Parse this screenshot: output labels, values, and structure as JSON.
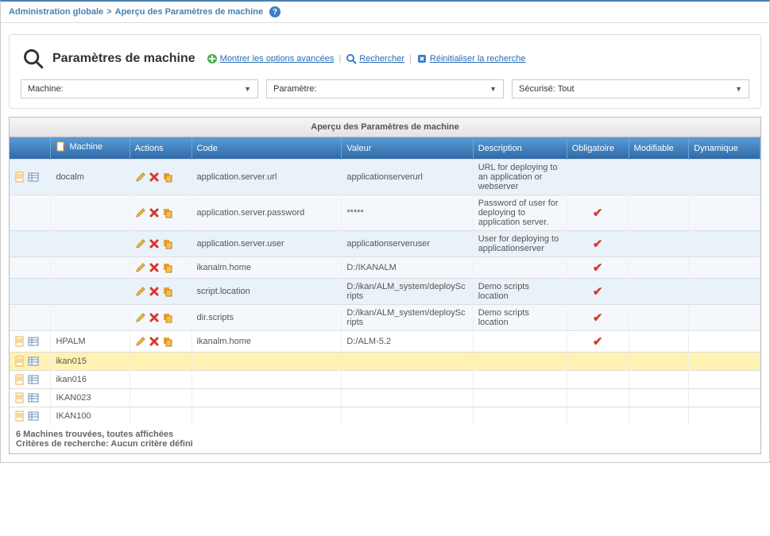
{
  "breadcrumb": {
    "root": "Administration globale",
    "sep": ">",
    "current": "Aperçu des Paramètres de machine"
  },
  "search": {
    "title": "Paramètres de machine",
    "advanced": "Montrer les options avancées",
    "search": "Rechercher",
    "reset": "Réinitialiser la recherche"
  },
  "filters": {
    "machine": "Machine:",
    "param": "Paramètre:",
    "secure": "Sécurisé: Tout"
  },
  "table": {
    "title": "Aperçu des Paramètres de machine",
    "headers": {
      "blank": "",
      "machine": "Machine",
      "actions": "Actions",
      "code": "Code",
      "value": "Valeur",
      "description": "Description",
      "mandatory": "Obligatoire",
      "editable": "Modifiable",
      "dynamic": "Dynamique"
    },
    "rows": [
      {
        "kind": "param",
        "alt": false,
        "showMachine": true,
        "machine": "docalm",
        "code": "application.server.url",
        "value": "applicationserverurl",
        "desc": "URL for deploying to an application or webserver",
        "mandatory": false
      },
      {
        "kind": "param",
        "alt": true,
        "showMachine": false,
        "machine": "",
        "code": "application.server.password",
        "value": "*****",
        "desc": "Password of user for deploying to application server.",
        "mandatory": true
      },
      {
        "kind": "param",
        "alt": false,
        "showMachine": false,
        "machine": "",
        "code": "application.server.user",
        "value": "applicationserveruser",
        "desc": "User for deploying to applicationserver",
        "mandatory": true
      },
      {
        "kind": "param",
        "alt": true,
        "showMachine": false,
        "machine": "",
        "code": "ikanalm.home",
        "value": "D:/IKANALM",
        "desc": "",
        "mandatory": true
      },
      {
        "kind": "param",
        "alt": false,
        "showMachine": false,
        "machine": "",
        "code": "script.location",
        "value": "D:/ikan/ALM_system/deployScripts",
        "desc": "Demo scripts location",
        "mandatory": true
      },
      {
        "kind": "param",
        "alt": true,
        "showMachine": false,
        "machine": "",
        "code": "dir.scripts",
        "value": "D:/ikan/ALM_system/deployScripts",
        "desc": "Demo scripts location",
        "mandatory": true
      },
      {
        "kind": "param",
        "alt": false,
        "plain": true,
        "showMachine": true,
        "machine": "HPALM",
        "code": "ikanalm.home",
        "value": "D:/ALM-5.2",
        "desc": "",
        "mandatory": true
      },
      {
        "kind": "machine",
        "highlight": true,
        "machine": "ikan015"
      },
      {
        "kind": "machine",
        "highlight": false,
        "machine": "ikan016"
      },
      {
        "kind": "machine",
        "highlight": false,
        "machine": "IKAN023"
      },
      {
        "kind": "machine",
        "highlight": false,
        "machine": "IKAN100"
      }
    ]
  },
  "footer": {
    "line1": "6 Machines trouvées, toutes affichées",
    "line2": "Critères de recherche: Aucun critère défini"
  },
  "glyphs": {
    "check": "✔"
  }
}
